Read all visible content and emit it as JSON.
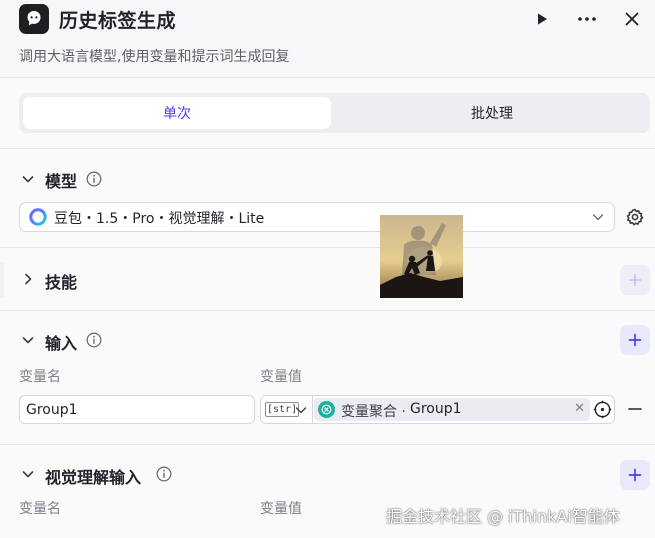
{
  "node": {
    "title": "历史标签生成",
    "description": "调用大语言模型,使用变量和提示词生成回复"
  },
  "mode_tabs": [
    {
      "label": "单次",
      "active": true
    },
    {
      "label": "批处理",
      "active": false
    }
  ],
  "model_section": {
    "title": "模型",
    "selected_model": "豆包・1.5・Pro・视觉理解・Lite"
  },
  "skills_section": {
    "title": "技能"
  },
  "input_section": {
    "title": "输入",
    "col_name": "变量名",
    "col_value": "变量值",
    "row": {
      "name": "Group1",
      "type_badge": "[str]",
      "ref_source": "变量聚合 ·",
      "ref_var": "Group1"
    }
  },
  "vision_section": {
    "title": "视觉理解输入",
    "col_name": "变量名",
    "col_value": "变量值"
  },
  "watermark": "掘金技术社区 @ iThinkAi智能体",
  "colors": {
    "accent": "#4e40e5",
    "ref_icon": "#17b3a0"
  }
}
